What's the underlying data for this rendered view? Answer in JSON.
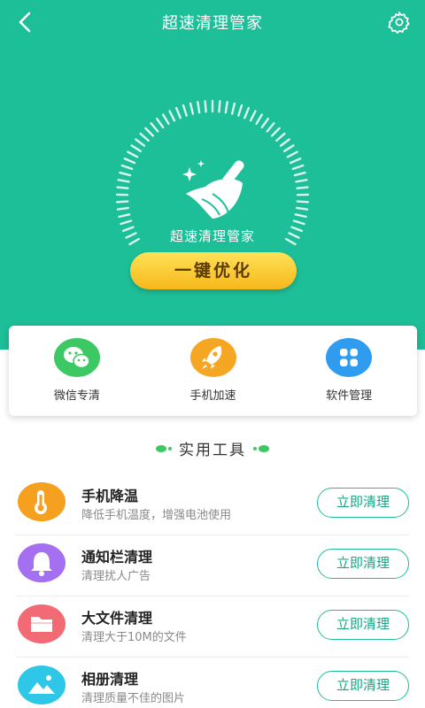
{
  "header": {
    "title": "超速清理管家",
    "back_icon": "chevron-left-icon",
    "settings_icon": "gear-icon"
  },
  "hero": {
    "brand_label": "超速清理管家",
    "optimize_label": "一键优化",
    "icon": "broom-icon",
    "colors": {
      "accent": "#1dbf98",
      "button_top": "#ffe257",
      "button_bottom": "#f7b71b"
    }
  },
  "quick_actions": [
    {
      "label": "微信专清",
      "icon": "wechat-icon",
      "color": "#3cc863"
    },
    {
      "label": "手机加速",
      "icon": "rocket-icon",
      "color": "#f5a623"
    },
    {
      "label": "软件管理",
      "icon": "app-grid-icon",
      "color": "#2f9cf0"
    }
  ],
  "tools_section": {
    "title": "实用工具",
    "items": [
      {
        "name": "手机降温",
        "desc": "降低手机温度，增强电池使用",
        "button": "立即清理",
        "icon": "thermometer-icon",
        "color": "#f5a01f"
      },
      {
        "name": "通知栏清理",
        "desc": "清理扰人广告",
        "button": "立即清理",
        "icon": "bell-icon",
        "color": "#a46ff0"
      },
      {
        "name": "大文件清理",
        "desc": "清理大于10M的文件",
        "button": "立即清理",
        "icon": "folder-icon",
        "color": "#f26b74"
      },
      {
        "name": "相册清理",
        "desc": "清理质量不佳的图片",
        "button": "立即清理",
        "icon": "photo-icon",
        "color": "#2fc7e8"
      }
    ]
  }
}
